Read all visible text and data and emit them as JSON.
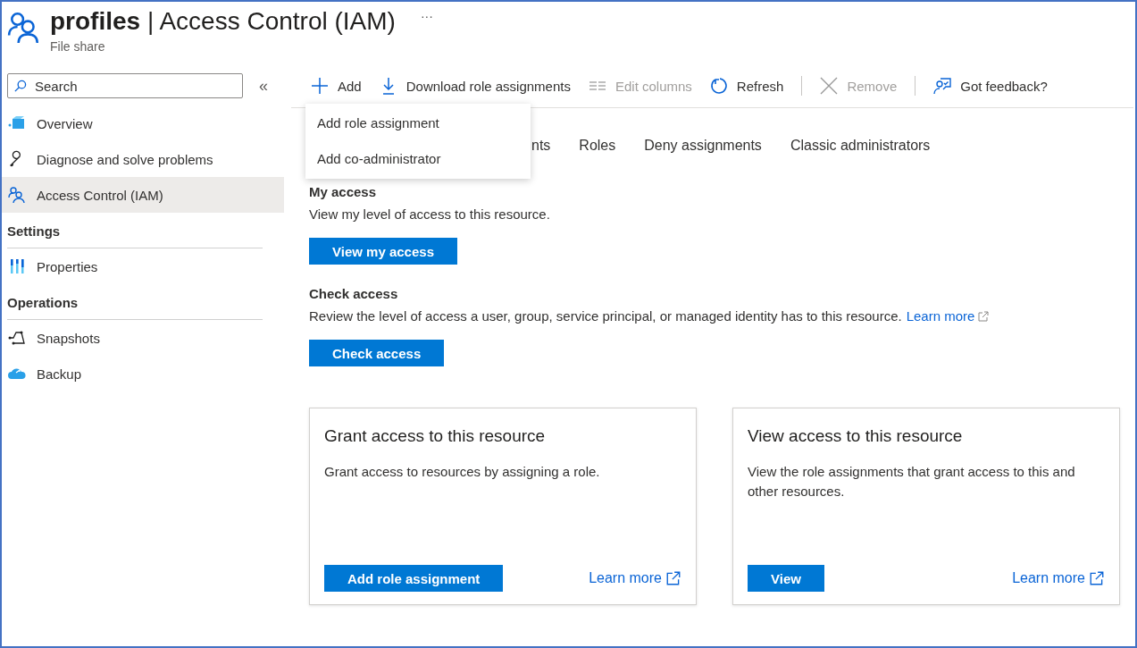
{
  "header": {
    "title_bold": "profiles",
    "separator": "|",
    "title_rest": "Access Control (IAM)",
    "more": "···",
    "subtitle": "File share"
  },
  "sidebar": {
    "search": {
      "placeholder": "Search"
    },
    "collapse": "«",
    "items": [
      {
        "label": "Overview",
        "kind": "overview",
        "selected": false
      },
      {
        "label": "Diagnose and solve problems",
        "kind": "wrench",
        "selected": false
      },
      {
        "label": "Access Control (IAM)",
        "kind": "people",
        "selected": true
      }
    ],
    "sections": [
      {
        "title": "Settings",
        "items": [
          {
            "label": "Properties",
            "kind": "properties",
            "selected": false
          }
        ]
      },
      {
        "title": "Operations",
        "items": [
          {
            "label": "Snapshots",
            "kind": "snapshots",
            "selected": false
          },
          {
            "label": "Backup",
            "kind": "backup",
            "selected": false
          }
        ]
      }
    ]
  },
  "toolbar": [
    {
      "label": "Add",
      "kind": "plus",
      "disabled": false
    },
    {
      "label": "Download role assignments",
      "kind": "download",
      "disabled": false
    },
    {
      "label": "Edit columns",
      "kind": "columns",
      "disabled": true
    },
    {
      "label": "Refresh",
      "kind": "refresh",
      "disabled": false,
      "divider_after": true
    },
    {
      "label": "Remove",
      "kind": "close",
      "disabled": true,
      "divider_after": true
    },
    {
      "label": "Got feedback?",
      "kind": "feedback",
      "disabled": false
    }
  ],
  "dropdown": [
    "Add role assignment",
    "Add co-administrator"
  ],
  "tabs": [
    {
      "label": "nts",
      "selected": false
    },
    {
      "label": "Roles",
      "selected": false
    },
    {
      "label": "Deny assignments",
      "selected": false
    },
    {
      "label": "Classic administrators",
      "selected": false
    }
  ],
  "my_access": {
    "title": "My access",
    "text": "View my level of access to this resource.",
    "button": "View my access"
  },
  "check_access": {
    "title": "Check access",
    "text": "Review the level of access a user, group, service principal, or managed identity has to this resource.",
    "link": "Learn more",
    "button": "Check access"
  },
  "cards": [
    {
      "title": "Grant access to this resource",
      "text": "Grant access to resources by assigning a role.",
      "button": "Add role assignment",
      "link": "Learn more"
    },
    {
      "title": "View access to this resource",
      "text": "View the role assignments that grant access to this and other resources.",
      "button": "View",
      "link": "Learn more"
    }
  ]
}
